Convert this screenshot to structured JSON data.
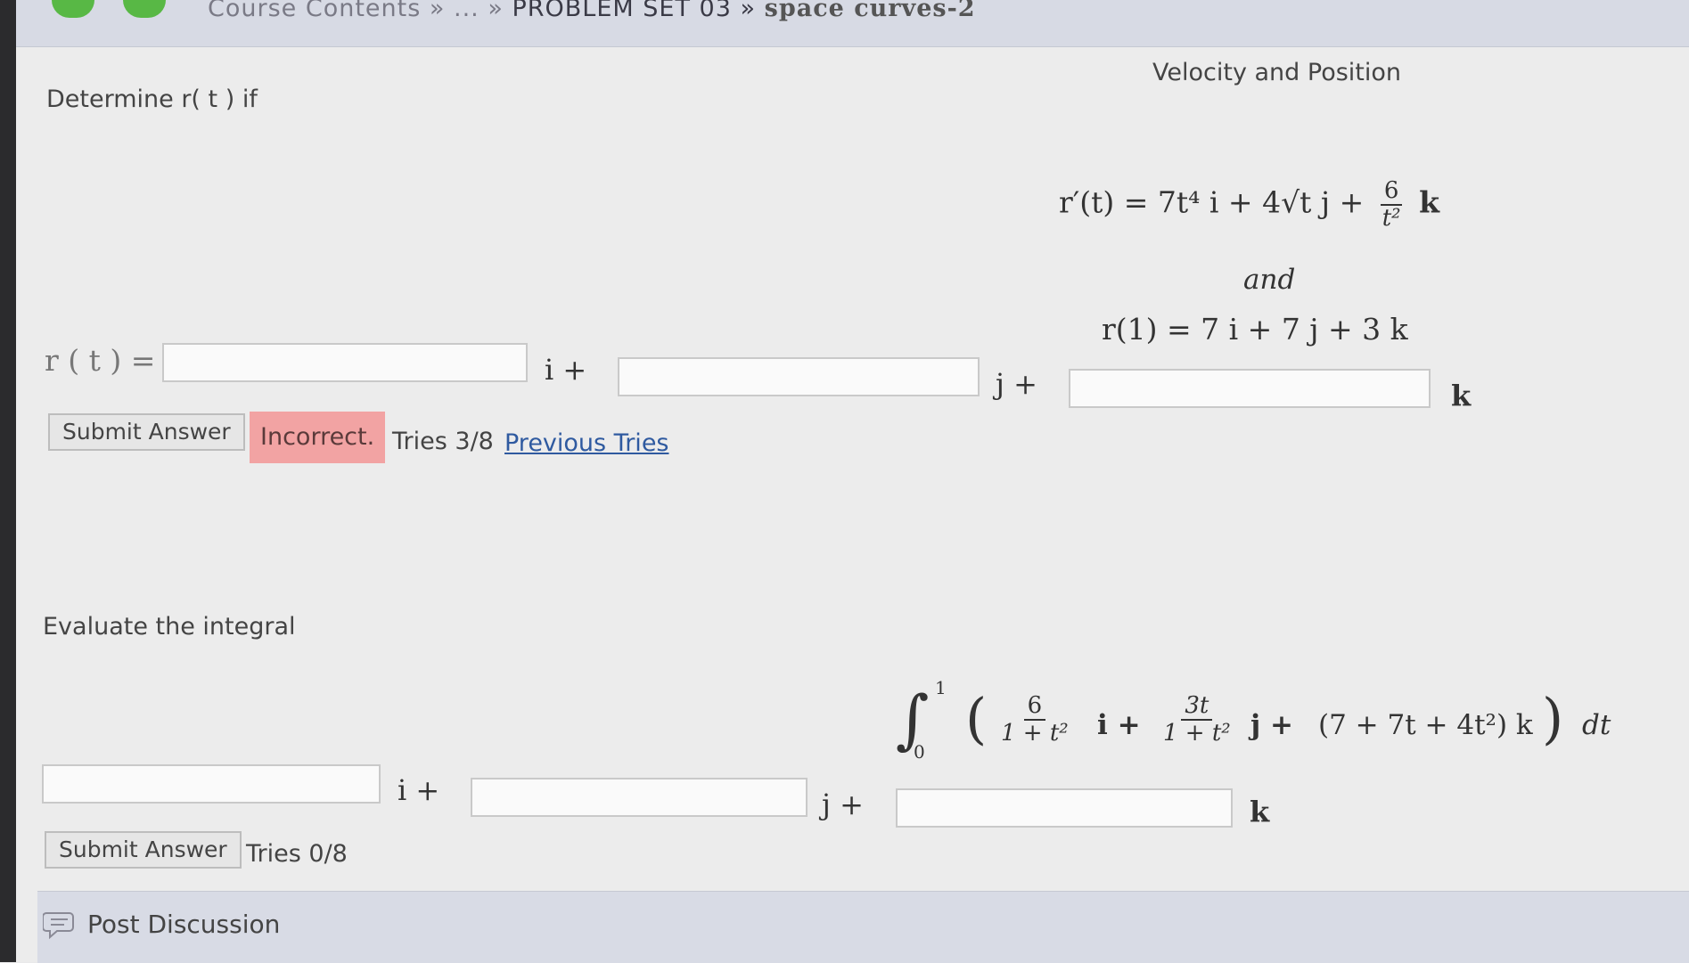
{
  "breadcrumb": {
    "start": "Course Contents",
    "sep1": "»",
    "ellipsis": "...",
    "sep2": "»",
    "problem_set": "PROBLEM SET 03",
    "sep3": "»",
    "title": "space curves-2"
  },
  "section_title": "Velocity and Position",
  "q1": {
    "prompt": "Determine r( t ) if",
    "velocity_lhs": "r′(t) = 7t⁴ i + 4√t j +",
    "frac_num": "6",
    "frac_den": "t²",
    "velocity_k": "k",
    "and_text": "and",
    "initial": "r(1) = 7 i + 7 j + 3 k",
    "answer_label": "r ( t ) =",
    "unit_i": "i +",
    "unit_j": "j +",
    "unit_k": "k",
    "input_values": [
      "",
      "",
      ""
    ],
    "submit_label": "Submit Answer",
    "status": "Incorrect.",
    "tries": "Tries 3/8",
    "previous_tries": "Previous Tries"
  },
  "q2": {
    "prompt": "Evaluate the integral",
    "int_lower": "0",
    "int_upper": "1",
    "term1_num": "6",
    "term1_den": "1 + t²",
    "term1_unit": "i +",
    "term2_num": "3t",
    "term2_den": "1 + t²",
    "term2_unit": "j +",
    "term3": "(7 + 7t + 4t²) k",
    "dt": "dt",
    "unit_i": "i +",
    "unit_j": "j +",
    "unit_k": "k",
    "input_values": [
      "",
      "",
      ""
    ],
    "submit_label": "Submit Answer",
    "tries": "Tries 0/8"
  },
  "footer": {
    "post_discussion": "Post Discussion",
    "icon": "speech-bubble-icon"
  }
}
